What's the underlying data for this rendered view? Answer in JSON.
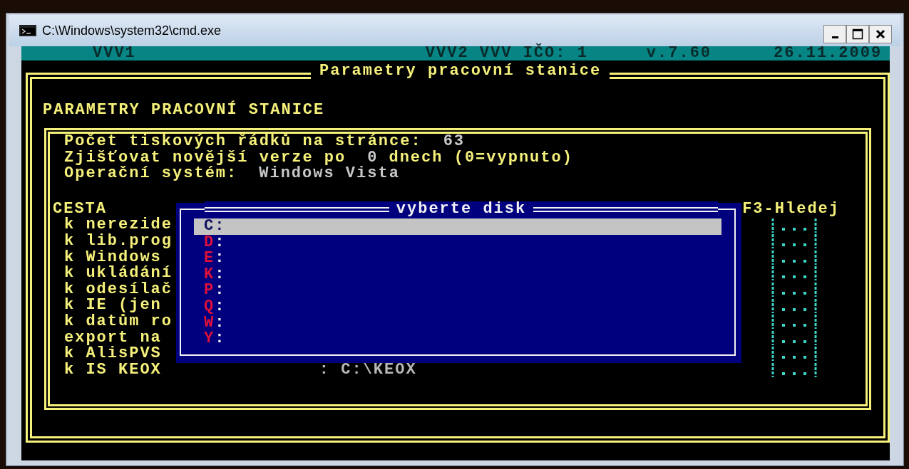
{
  "window": {
    "title": "C:\\Windows\\system32\\cmd.exe"
  },
  "header": [
    "VVV1",
    "VVV2 VVV IČO: 1",
    "v.7.60",
    "26.11.2009"
  ],
  "frame_title": "Parametry pracovní stanice",
  "section_title": "PARAMETRY PRACOVNÍ STANICE",
  "settings": [
    {
      "parts": [
        {
          "kind": "label",
          "text": "Počet tiskových řádků na stránce:"
        },
        {
          "kind": "value",
          "text": "63"
        }
      ]
    },
    {
      "parts": [
        {
          "kind": "label",
          "text": "Zjišťovat novější verze po"
        },
        {
          "kind": "value",
          "text": "0"
        },
        {
          "kind": "label",
          "text": "dnech (0=vypnuto)"
        }
      ]
    },
    {
      "parts": [
        {
          "kind": "label",
          "text": "Operační systém:"
        },
        {
          "kind": "value",
          "text": "Windows Vista"
        }
      ]
    }
  ],
  "paths": {
    "heading": "CESTA",
    "hint": "F3-Hledej",
    "rows": [
      {
        "label": "k nerezide"
      },
      {
        "label": "k lib.prog"
      },
      {
        "label": "k Windows"
      },
      {
        "label": "k ukládání"
      },
      {
        "label": "k odesílač"
      },
      {
        "label": "k IE (jen"
      },
      {
        "label": "k datům ro"
      },
      {
        "label": "export na"
      },
      {
        "label": "k AlisPVS"
      },
      {
        "label": "k IS KEOX",
        "value": ": C:\\KEOX"
      }
    ]
  },
  "dialog": {
    "title": "vyberte disk",
    "items": [
      {
        "hotkey": "C",
        "rest": ":",
        "selected": true
      },
      {
        "hotkey": "D",
        "rest": ":",
        "selected": false
      },
      {
        "hotkey": "E",
        "rest": ":",
        "selected": false
      },
      {
        "hotkey": "K",
        "rest": ":",
        "selected": false
      },
      {
        "hotkey": "P",
        "rest": ":",
        "selected": false
      },
      {
        "hotkey": "Q",
        "rest": ":",
        "selected": false
      },
      {
        "hotkey": "W",
        "rest": ":",
        "selected": false
      },
      {
        "hotkey": "Y",
        "rest": ":",
        "selected": false
      }
    ]
  }
}
